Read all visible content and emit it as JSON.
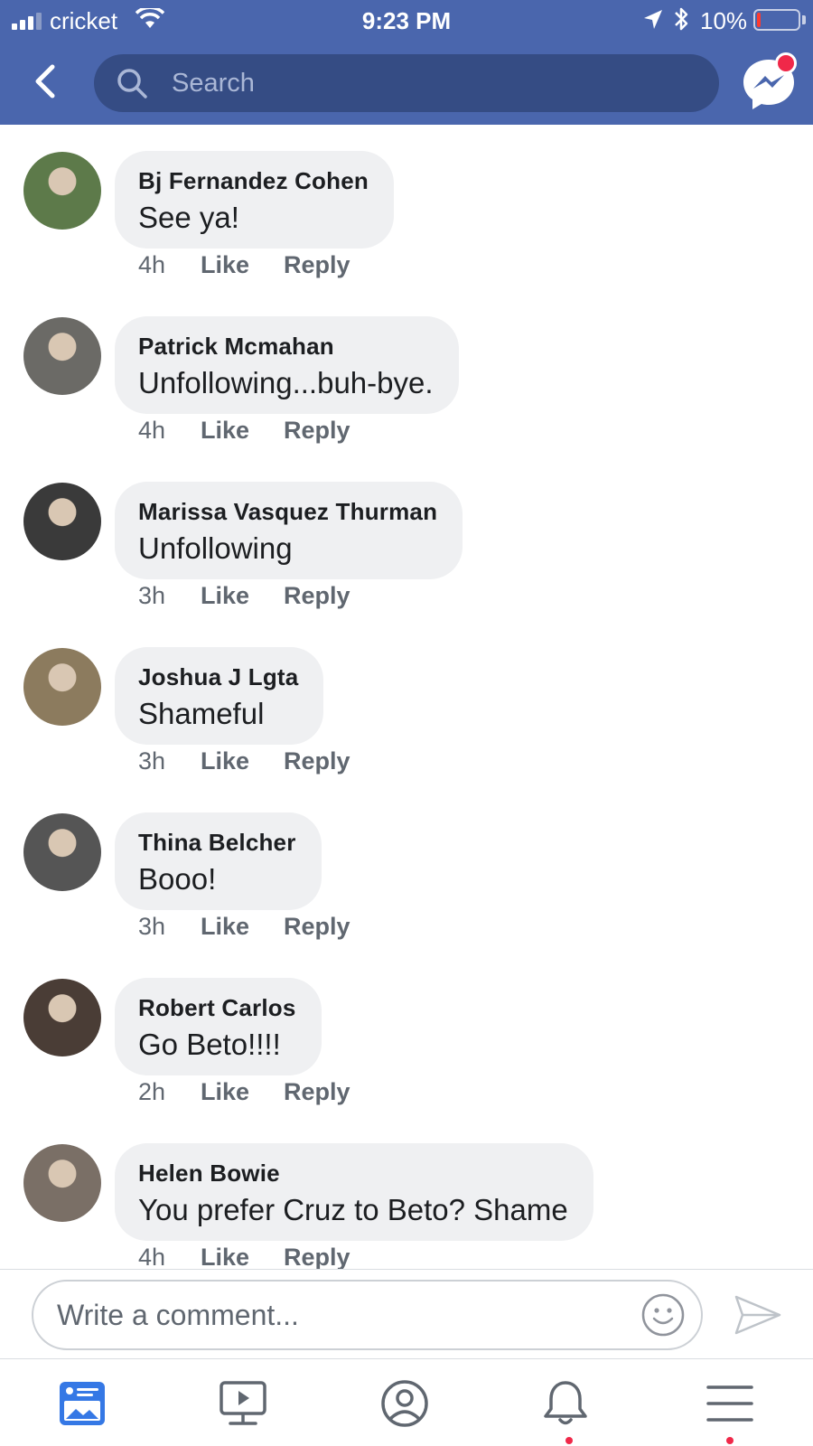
{
  "status_bar": {
    "carrier": "cricket",
    "time": "9:23 PM",
    "battery": "10%",
    "battery_level": 0.1
  },
  "header": {
    "search_placeholder": "Search",
    "icons": [
      "back-chevron-icon",
      "search-icon",
      "messenger-icon"
    ],
    "messenger_notification": true
  },
  "comments": [
    {
      "name": "Bj Fernandez Cohen",
      "text": "See ya!",
      "time": "4h",
      "like": "Like",
      "reply": "Reply",
      "avatar_color": "#5d7a4a"
    },
    {
      "name": "Patrick Mcmahan",
      "text": "Unfollowing...buh-bye.",
      "time": "4h",
      "like": "Like",
      "reply": "Reply",
      "avatar_color": "#6b6a66"
    },
    {
      "name": "Marissa Vasquez Thurman",
      "text": "Unfollowing",
      "time": "3h",
      "like": "Like",
      "reply": "Reply",
      "avatar_color": "#3a3a3a"
    },
    {
      "name": "Joshua J Lgta",
      "text": "Shameful",
      "time": "3h",
      "like": "Like",
      "reply": "Reply",
      "avatar_color": "#8c7b5e"
    },
    {
      "name": "Thina Belcher",
      "text": "Booo!",
      "time": "3h",
      "like": "Like",
      "reply": "Reply",
      "avatar_color": "#555555"
    },
    {
      "name": "Robert Carlos",
      "text": "Go Beto!!!!",
      "time": "2h",
      "like": "Like",
      "reply": "Reply",
      "avatar_color": "#4a3d36"
    },
    {
      "name": "Helen Bowie",
      "text": "You prefer Cruz to Beto? Shame",
      "time": "4h",
      "like": "Like",
      "reply": "Reply",
      "avatar_color": "#7a6f66"
    }
  ],
  "composer": {
    "placeholder": "Write a comment...",
    "icons": [
      "emoji-icon",
      "send-icon"
    ]
  },
  "tab_bar": {
    "tabs": [
      "news-feed-icon",
      "watch-icon",
      "profile-icon",
      "notifications-icon",
      "menu-icon"
    ],
    "active_tab": "news-feed-icon",
    "dots_on": [
      "notifications-icon",
      "menu-icon"
    ]
  },
  "colors": {
    "brand": "#4a66ad",
    "search_bg": "#354c84",
    "bubble": "#eff0f2",
    "notification": "#f02849",
    "active_tab": "#3578e5",
    "inactive_tab": "#606770"
  }
}
